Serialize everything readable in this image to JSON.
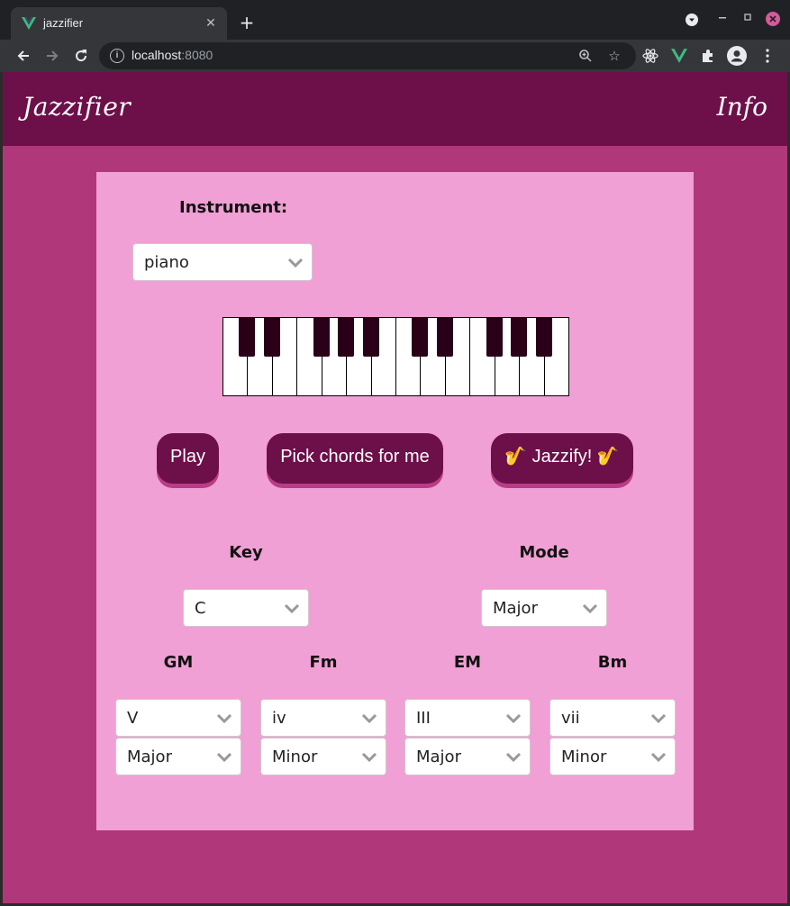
{
  "browser": {
    "tab_title": "jazzifier",
    "tab_close": "✕",
    "new_tab": "+",
    "url_host": "localhost",
    "url_port": ":8080"
  },
  "header": {
    "brand": "Jazzifier",
    "info": "Info"
  },
  "instrument": {
    "label": "Instrument:",
    "value": "piano"
  },
  "buttons": {
    "play": "Play",
    "pick": "Pick chords for me",
    "jazzify_emoji": "🎷",
    "jazzify": "Jazzify!"
  },
  "key": {
    "label": "Key",
    "value": "C"
  },
  "mode": {
    "label": "Mode",
    "value": "Major"
  },
  "chords": [
    {
      "name": "GM",
      "degree": "V",
      "quality": "Major"
    },
    {
      "name": "Fm",
      "degree": "iv",
      "quality": "Minor"
    },
    {
      "name": "EM",
      "degree": "III",
      "quality": "Major"
    },
    {
      "name": "Bm",
      "degree": "vii",
      "quality": "Minor"
    }
  ],
  "colors": {
    "header": "#6d0f49",
    "page_bg": "#b0377a",
    "panel_bg": "#f0a0d4",
    "button": "#6d0f49",
    "black_key": "#2a0018"
  }
}
